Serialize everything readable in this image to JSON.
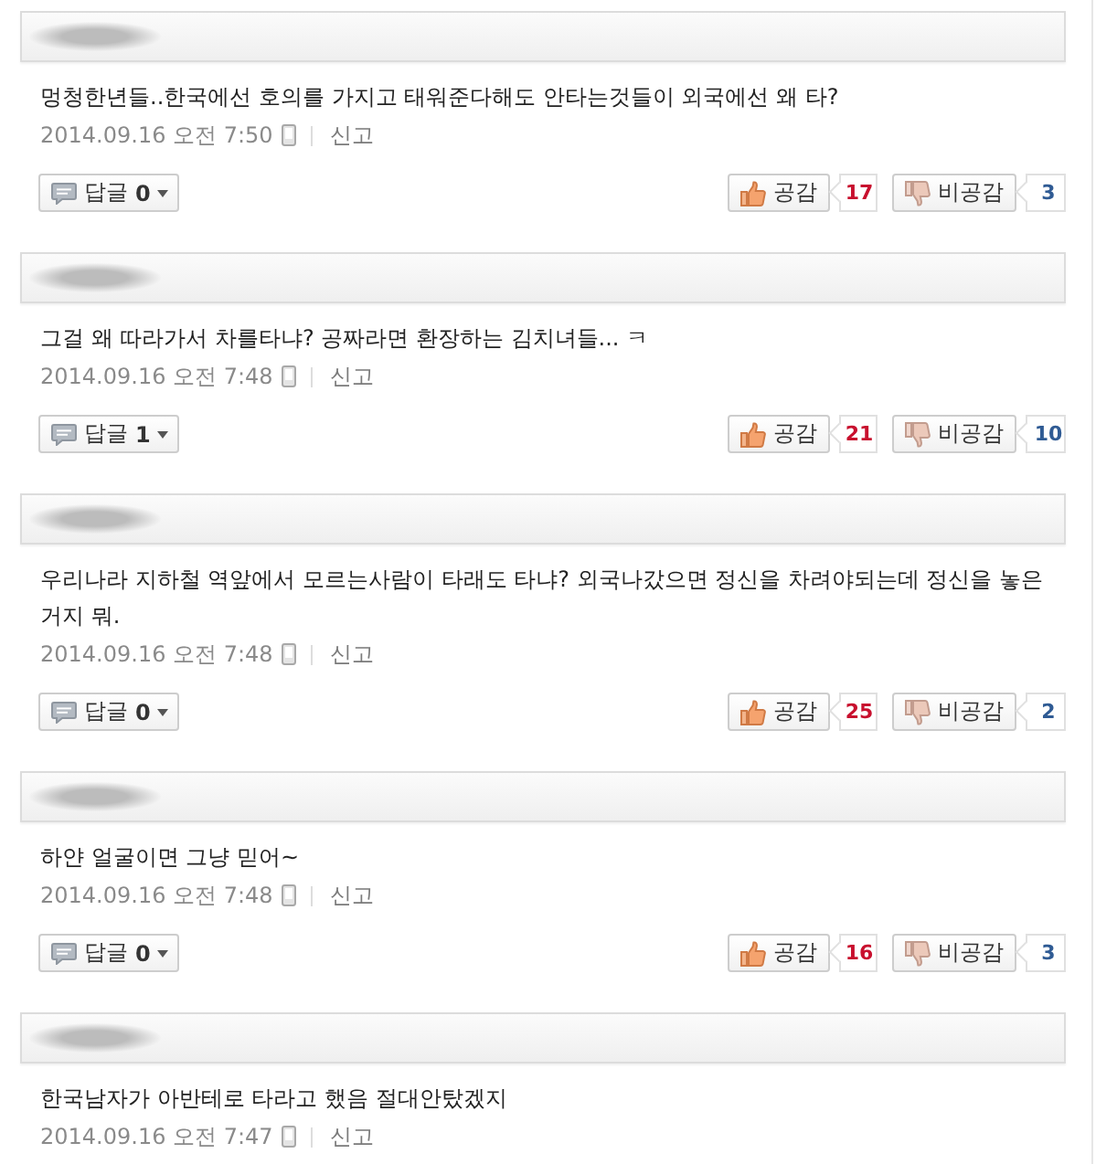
{
  "comments": [
    {
      "text": "멍청한년들..한국에선 호의를 가지고 태워준다해도 안타는것들이 외국에선 왜 타?",
      "date": "2014.09.16 오전 7:50",
      "mobile": true,
      "report": "신고",
      "reply": {
        "label": "답글",
        "count": "0"
      },
      "like": {
        "label": "공감",
        "count": "17"
      },
      "dislike": {
        "label": "비공감",
        "count": "3"
      }
    },
    {
      "text": "그걸 왜 따라가서 차를타냐? 공짜라면 환장하는 김치녀들... ㅋ",
      "date": "2014.09.16 오전 7:48",
      "mobile": true,
      "report": "신고",
      "reply": {
        "label": "답글",
        "count": "1"
      },
      "like": {
        "label": "공감",
        "count": "21"
      },
      "dislike": {
        "label": "비공감",
        "count": "10"
      }
    },
    {
      "text": "우리나라 지하철 역앞에서 모르는사람이 타래도 타냐? 외국나갔으면 정신을 차려야되는데 정신을 놓은 거지 뭐.",
      "date": "2014.09.16 오전 7:48",
      "mobile": true,
      "report": "신고",
      "reply": {
        "label": "답글",
        "count": "0"
      },
      "like": {
        "label": "공감",
        "count": "25"
      },
      "dislike": {
        "label": "비공감",
        "count": "2"
      }
    },
    {
      "text": "하얀 얼굴이면 그냥 믿어~",
      "date": "2014.09.16 오전 7:48",
      "mobile": true,
      "report": "신고",
      "reply": {
        "label": "답글",
        "count": "0"
      },
      "like": {
        "label": "공감",
        "count": "16"
      },
      "dislike": {
        "label": "비공감",
        "count": "3"
      }
    },
    {
      "text": "한국남자가 아반테로 타라고 했음 절대안탔겠지",
      "date": "2014.09.16 오전 7:47",
      "mobile": true,
      "report": "신고"
    }
  ]
}
